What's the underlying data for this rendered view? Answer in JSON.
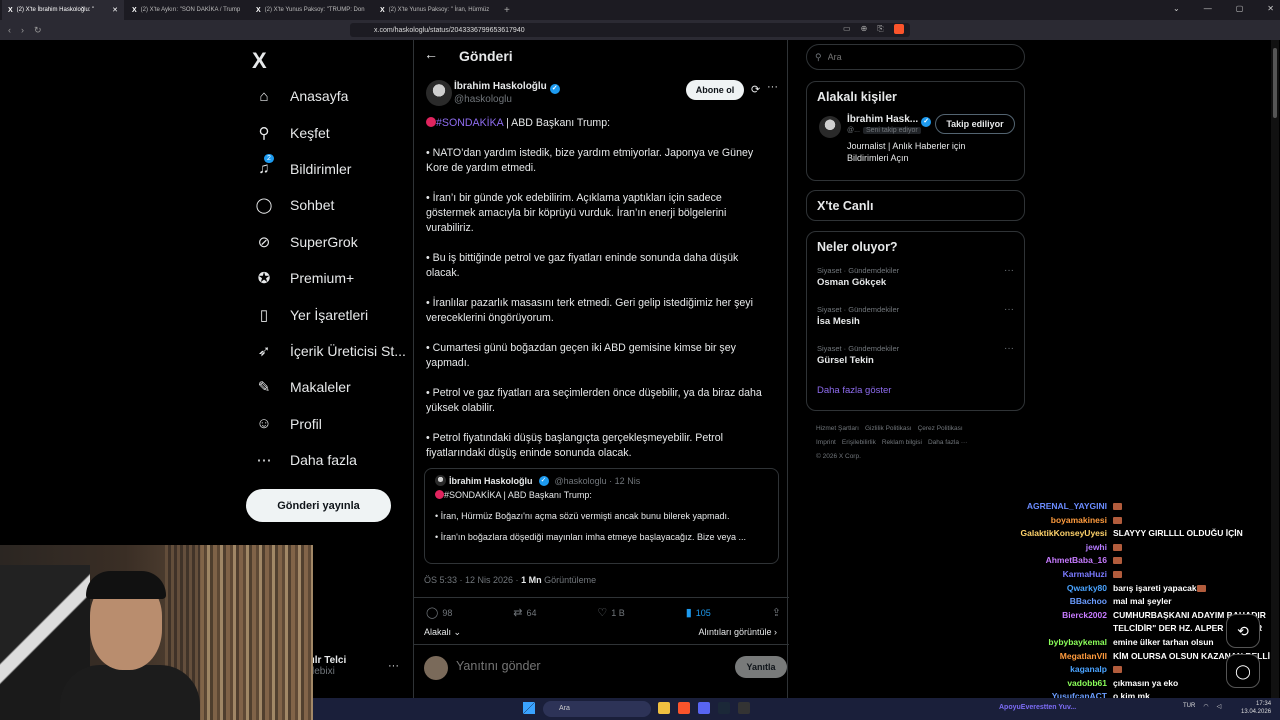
{
  "browser": {
    "tabs": [
      {
        "title": "(2) X'te İbrahim Haskoloğlu: \"",
        "active": true
      },
      {
        "title": "(2) X'te Aykırı: \"SON DAKİKA / Trump",
        "active": false
      },
      {
        "title": "(2) X'te Yunus Paksoy: \"TRUMP: Don",
        "active": false
      },
      {
        "title": "(2) X'te Yunus Paksoy: \" İran, Hürmüz",
        "active": false
      }
    ],
    "url": "x.com/haskologlu/status/2043336799653617940"
  },
  "sidebar": {
    "logo": "X",
    "items": [
      {
        "label": "Anasayfa",
        "icon": "home-icon",
        "glyph": "⌂"
      },
      {
        "label": "Keşfet",
        "icon": "search-icon",
        "glyph": "⚲"
      },
      {
        "label": "Bildirimler",
        "icon": "bell-icon",
        "glyph": "♫",
        "badge": "2"
      },
      {
        "label": "Sohbet",
        "icon": "chat-icon",
        "glyph": "◯"
      },
      {
        "label": "SuperGrok",
        "icon": "grok-icon",
        "glyph": "⊘"
      },
      {
        "label": "Premium+",
        "icon": "premium-icon",
        "glyph": "✪"
      },
      {
        "label": "Yer İşaretleri",
        "icon": "bookmark-icon",
        "glyph": "▯"
      },
      {
        "label": "İçerik Üreticisi St...",
        "icon": "rocket-icon",
        "glyph": "➶"
      },
      {
        "label": "Makaleler",
        "icon": "article-icon",
        "glyph": "✎"
      },
      {
        "label": "Profil",
        "icon": "profile-icon",
        "glyph": "☺"
      },
      {
        "label": "Daha fazla",
        "icon": "more-circle-icon",
        "glyph": "⋯"
      }
    ],
    "post_button": "Gönderi yayınla",
    "account_name": "ılr Telci",
    "account_handle": "lebixi"
  },
  "main": {
    "title": "Gönderi",
    "author": {
      "name": "İbrahim Haskoloğlu",
      "handle": "@haskologlu"
    },
    "subscribe_label": "Abone ol",
    "hashtag": "#SONDAKİKA",
    "headline_rest": " | ABD Başkanı Trump:",
    "paragraphs": [
      "• NATO’dan yardım istedik, bize yardım etmiyorlar. Japonya ve Güney Kore de yardım etmedi.",
      "• İran’ı bir günde yok edebilirim. Açıklama yaptıkları için sadece göstermek amacıyla bir köprüyü vurduk. İran’ın enerji bölgelerini vurabiliriz.",
      "• Bu iş bittiğinde petrol ve gaz fiyatları eninde sonunda daha düşük olacak.",
      "• İranlılar pazarlık masasını terk etmedi. Geri gelip istediğimiz her şeyi vereceklerini öngörüyorum.",
      "• Cumartesi günü boğazdan geçen iki ABD gemisine kimse bir şey yapmadı.",
      "• Petrol ve gaz fiyatları ara seçimlerden önce düşebilir, ya da biraz daha yüksek olabilir.",
      "• Petrol fiyatındaki düşüş başlangıçta gerçekleşmeyebilir. Petrol fiyatlarındaki düşüş eninde sonunda olacak."
    ],
    "quote": {
      "name": "İbrahim Haskoloğlu",
      "meta": "@haskologlu · 12 Nis",
      "headline": "#SONDAKİKA | ABD Başkanı Trump:",
      "line1": "• İran, Hürmüz Boğazı'nı açma sözü vermişti ancak bunu bilerek yapmadı.",
      "line2": "• İran'ın boğazlara döşediği mayınları imha etmeye başlayacağız. Bize veya ..."
    },
    "timestamp": "ÖS 5:33 · 12 Nis 2026 · ",
    "views": "1 Mn",
    "views_label": " Görüntüleme",
    "stats": {
      "replies": "98",
      "reposts": "64",
      "likes": "1 B",
      "bookmarks": "105"
    },
    "related_label": "Alakalı",
    "quotes_label": "Alıntıları görüntüle",
    "reply_placeholder": "Yanıtını gönder",
    "reply_button": "Yanıtla"
  },
  "right": {
    "search_placeholder": "Ara",
    "related_title": "Alakalı kişiler",
    "person": {
      "name": "İbrahim Hask...",
      "handle": "@...",
      "follows_you": "Seni takip ediyor",
      "follow_label": "Takip ediliyor",
      "bio": "Journalist | Anlık Haberler için Bildirimleri Açın"
    },
    "live_title": "X'te Canlı",
    "trends_title": "Neler oluyor?",
    "trends": [
      {
        "category": "Siyaset · Gündemdekiler",
        "name": "Osman Gökçek"
      },
      {
        "category": "Siyaset · Gündemdekiler",
        "name": "İsa Mesih"
      },
      {
        "category": "Siyaset · Gündemdekiler",
        "name": "Gürsel Tekin"
      }
    ],
    "show_more": "Daha fazla göster",
    "footer": {
      "l1": [
        "Hizmet Şartları",
        "Gizlilik Politikası",
        "Çerez Politikası"
      ],
      "l2": [
        "Imprint",
        "Erişilebilirlik",
        "Reklam bilgisi",
        "Daha fazla ···"
      ],
      "l3": "© 2026 X Corp."
    }
  },
  "chat": [
    {
      "user": "AGRENAL_YAYGINI",
      "msg": "",
      "color": "#6b8cff",
      "emote": true
    },
    {
      "user": "boyamakinesi",
      "msg": "",
      "color": "#ff9b3d",
      "emote": true
    },
    {
      "user": "GalaktikKonseyUyesi",
      "msg": "SLAYYY GIRLLLL OLDUĞU İÇİN",
      "color": "#ffd36b",
      "emote": false
    },
    {
      "user": "jewhi",
      "msg": "",
      "color": "#b57bff",
      "emote": true
    },
    {
      "user": "AhmetBaba_16",
      "msg": "",
      "color": "#c77bff",
      "emote": true
    },
    {
      "user": "KarmaHuzi",
      "msg": "",
      "color": "#7a7aff",
      "emote": true
    },
    {
      "user": "Qwarky80",
      "msg": "barış işareti yapacak",
      "color": "#4aa3ff",
      "emote": true
    },
    {
      "user": "BBachoo",
      "msg": "mal mal şeyler",
      "color": "#6b9dff",
      "emote": false
    },
    {
      "user": "Bierck2002",
      "msg": "CUMHURBAŞKANI ADAYIM BAHADIR",
      "color": "#c77bff",
      "emote": false
    },
    {
      "user": "",
      "msg": "TELCİDİR\" DER HZ. ALPER ÇAĞLAR",
      "color": "#c77bff",
      "emote": false
    },
    {
      "user": "bybybaykemal",
      "msg": "emine ülker tarhan olsun",
      "color": "#8bff5a",
      "emote": false
    },
    {
      "user": "MegatlanVII",
      "msg": "KİM OLURSA OLSUN KAZANAN BELLİ",
      "color": "#ff9b3d",
      "emote": false
    },
    {
      "user": "kaganalp",
      "msg": "",
      "color": "#4aa3ff",
      "emote": true
    },
    {
      "user": "vadobb61",
      "msg": "çıkmasın ya eko",
      "color": "#8bff5a",
      "emote": false
    },
    {
      "user": "YusufcanACT",
      "msg": "o kim mk",
      "color": "#6b9dff",
      "emote": false
    }
  ],
  "taskbar": {
    "search": "Ara",
    "ticker": "ApoyuEverestten Yuv...",
    "lang": "TUR",
    "time": "17:34",
    "date": "13.04.2026"
  }
}
